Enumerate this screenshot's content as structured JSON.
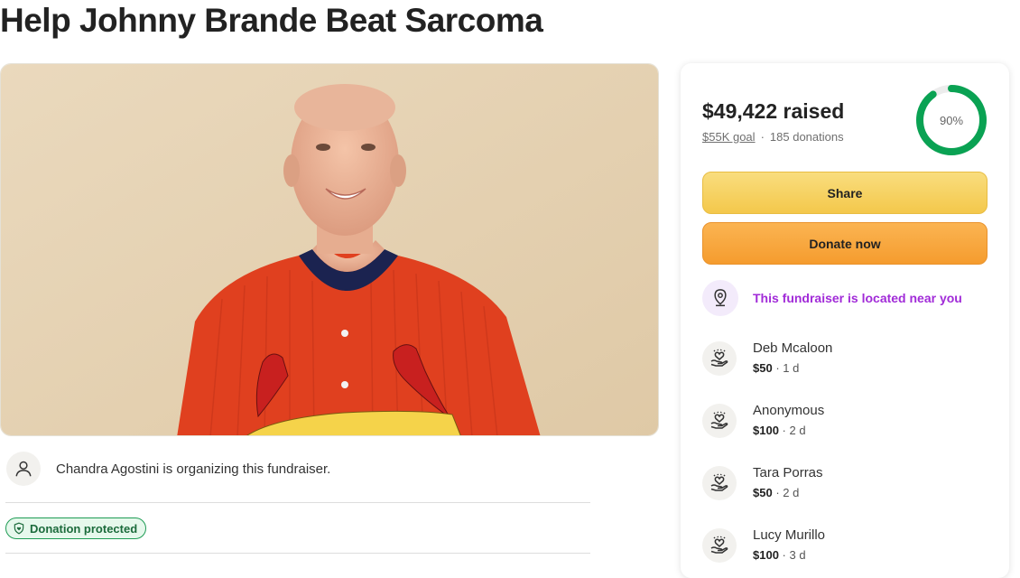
{
  "page": {
    "title": "Help Johnny Brande Beat Sarcoma"
  },
  "organizer": {
    "text": "Chandra Agostini is organizing this fundraiser.",
    "icon": "person-icon"
  },
  "badge": {
    "label": "Donation protected",
    "icon": "shield-heart-icon"
  },
  "summary": {
    "raised": "$49,422 raised",
    "goal": "$55K goal",
    "separator": "·",
    "donations": "185 donations",
    "percent_label": "90%",
    "progress_fraction": 0.9
  },
  "buttons": {
    "share": "Share",
    "donate": "Donate now"
  },
  "location": {
    "text": "This fundraiser is located near you",
    "icon": "location-pin-icon"
  },
  "donations": [
    {
      "name": "Deb Mcaloon",
      "amount": "$50",
      "time": "· 1 d"
    },
    {
      "name": "Anonymous",
      "amount": "$100",
      "time": "· 2 d"
    },
    {
      "name": "Tara Porras",
      "amount": "$50",
      "time": "· 2 d"
    },
    {
      "name": "Lucy Murillo",
      "amount": "$100",
      "time": "· 3 d"
    }
  ],
  "colors": {
    "progress": "#0aa253",
    "location_accent": "#a12bd8",
    "share_button": "#f4c84b",
    "donate_button": "#f59c2e",
    "badge_green": "#1f9c55"
  }
}
